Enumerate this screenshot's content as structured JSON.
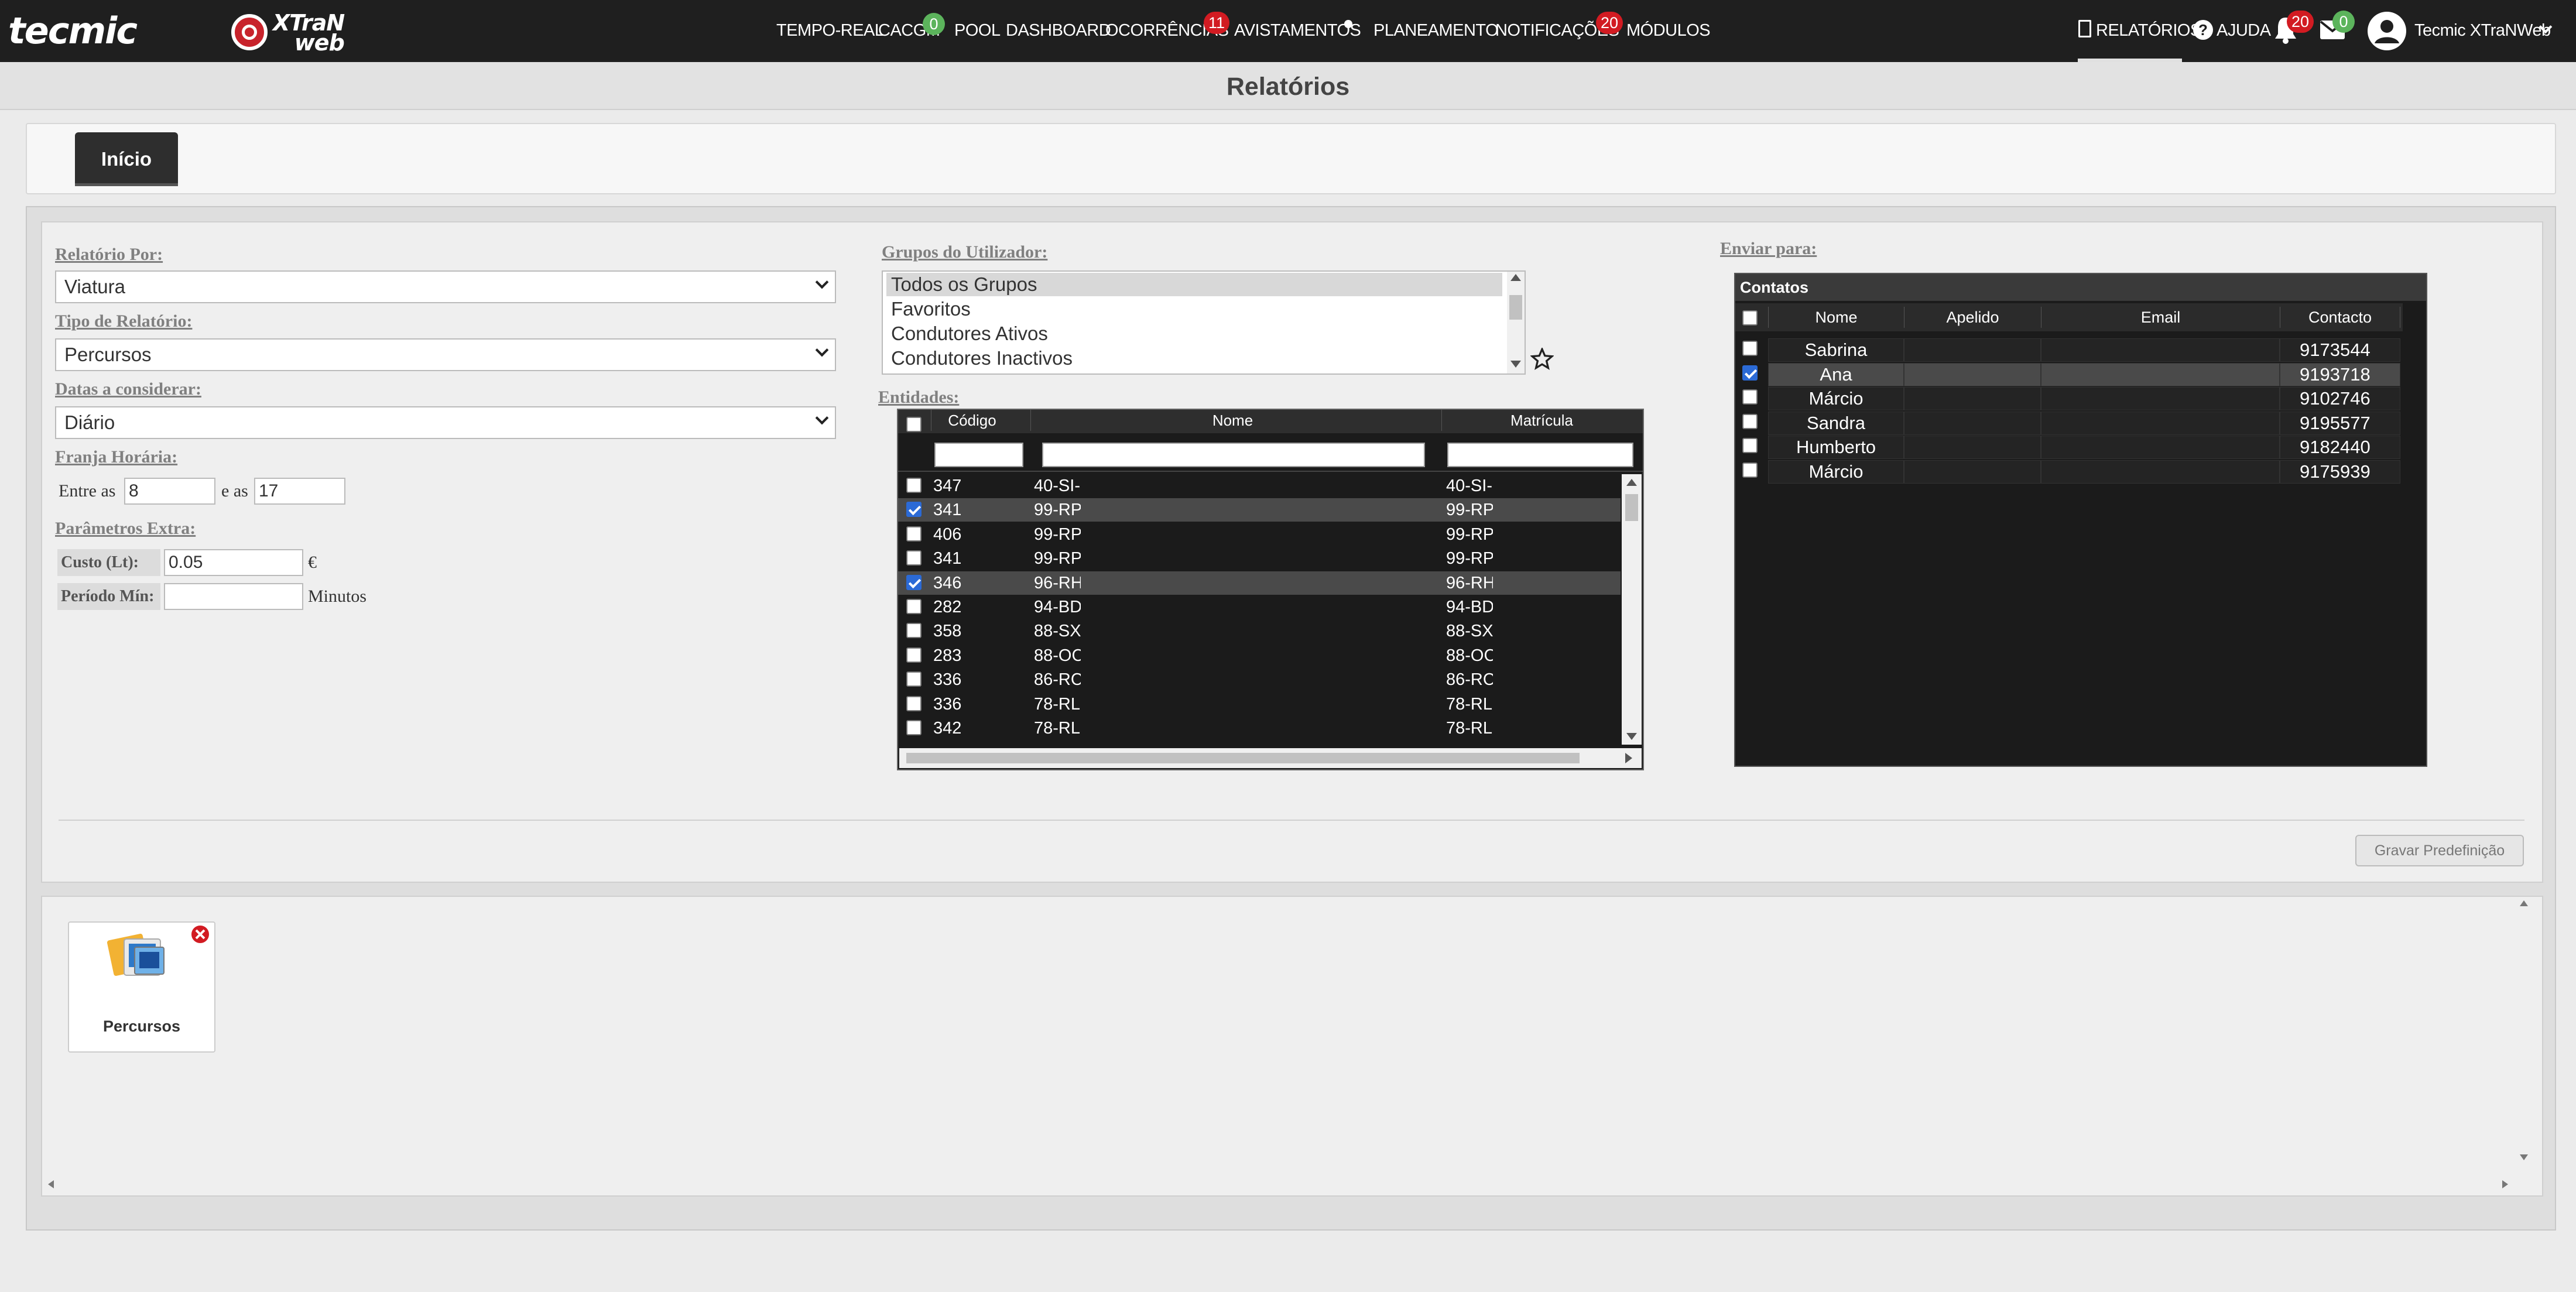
{
  "header": {
    "logo_brand": "tecmic",
    "logo_product": "XTraN web",
    "nav": [
      {
        "label": "TEMPO-REAL"
      },
      {
        "label": "CACGM",
        "badge": "0"
      },
      {
        "label": "POOL"
      },
      {
        "label": "DASHBOARD"
      },
      {
        "label": "OCORRÊNCIAS",
        "badge": "11"
      },
      {
        "label": "AVISTAMENTOS"
      },
      {
        "label": "PLANEAMENTO"
      },
      {
        "label": "NOTIFICAÇÕES",
        "badge": "20"
      },
      {
        "label": "MÓDULOS"
      }
    ],
    "relatorios_label": "RELATÓRIOS",
    "ajuda_label": "AJUDA",
    "bell_badge": "20",
    "mail_badge": "0",
    "user_name": "Tecmic XTraNWeb",
    "colors": {
      "bar": "#1f1f1f",
      "badge_red": "#d21b22",
      "badge_green": "#5cb45c"
    }
  },
  "page_title": "Relatórios",
  "tabs": [
    {
      "label": "Início",
      "active": true
    }
  ],
  "form": {
    "relatorio_por": {
      "label": "Relatório Por:",
      "value": "Viatura"
    },
    "tipo_relatorio": {
      "label": "Tipo de Relatório:",
      "value": "Percursos"
    },
    "datas": {
      "label": "Datas a considerar:",
      "value": "Diário"
    },
    "franja": {
      "label": "Franja Horária:",
      "entre_label": "Entre as",
      "from": "8",
      "e_label": "e as",
      "to": "17"
    },
    "extra": {
      "label": "Parâmetros Extra:",
      "custo_label": "Custo (Lt):",
      "custo_value": "0.05",
      "currency": "€",
      "periodo_label": "Período Mín:",
      "periodo_value": "",
      "minutos": "Minutos"
    },
    "grupos": {
      "label": "Grupos do Utilizador:",
      "items": [
        "Todos os Grupos",
        "Favoritos",
        "Condutores Ativos",
        "Condutores Inactivos"
      ],
      "selected": "Todos os Grupos"
    },
    "entidades": {
      "label": "Entidades:",
      "columns": [
        "Código",
        "Nome",
        "Matrícula"
      ],
      "rows": [
        {
          "codigo": "347",
          "nome": "40-SI-",
          "matricula": "40-SI-",
          "checked": false
        },
        {
          "codigo": "341",
          "nome": "99-RP",
          "matricula": "99-RP",
          "checked": true
        },
        {
          "codigo": "406",
          "nome": "99-RP",
          "matricula": "99-RP",
          "checked": false
        },
        {
          "codigo": "341",
          "nome": "99-RP",
          "matricula": "99-RP",
          "checked": false
        },
        {
          "codigo": "346",
          "nome": "96-RH",
          "matricula": "96-RH",
          "checked": true
        },
        {
          "codigo": "282",
          "nome": "94-BD",
          "matricula": "94-BD",
          "checked": false
        },
        {
          "codigo": "358",
          "nome": "88-SX",
          "matricula": "88-SX",
          "checked": false
        },
        {
          "codigo": "283",
          "nome": "88-OC",
          "matricula": "88-OC",
          "checked": false
        },
        {
          "codigo": "336",
          "nome": "86-RC",
          "matricula": "86-RC",
          "checked": false
        },
        {
          "codigo": "336",
          "nome": "78-RL",
          "matricula": "78-RL",
          "checked": false
        },
        {
          "codigo": "342",
          "nome": "78-RL",
          "matricula": "78-RL",
          "checked": false
        }
      ]
    },
    "enviar": {
      "label": "Enviar para:",
      "panel_title": "Contatos",
      "columns": [
        "Nome",
        "Apelido",
        "Email",
        "Contacto"
      ],
      "rows": [
        {
          "nome": "Sabrina",
          "apelido": "",
          "email": "",
          "contacto": "9173544",
          "checked": false
        },
        {
          "nome": "Ana",
          "apelido": "",
          "email": "",
          "contacto": "9193718",
          "checked": true
        },
        {
          "nome": "Márcio",
          "apelido": "",
          "email": "",
          "contacto": "9102746",
          "checked": false
        },
        {
          "nome": "Sandra",
          "apelido": "",
          "email": "",
          "contacto": "9195577",
          "checked": false
        },
        {
          "nome": "Humberto",
          "apelido": "",
          "email": "",
          "contacto": "9182440",
          "checked": false
        },
        {
          "nome": "Márcio",
          "apelido": "",
          "email": "",
          "contacto": "9175939",
          "checked": false
        }
      ]
    },
    "save_label": "Gravar Predefinição"
  },
  "reports": [
    {
      "label": "Percursos",
      "icon": "report-images-icon"
    }
  ]
}
